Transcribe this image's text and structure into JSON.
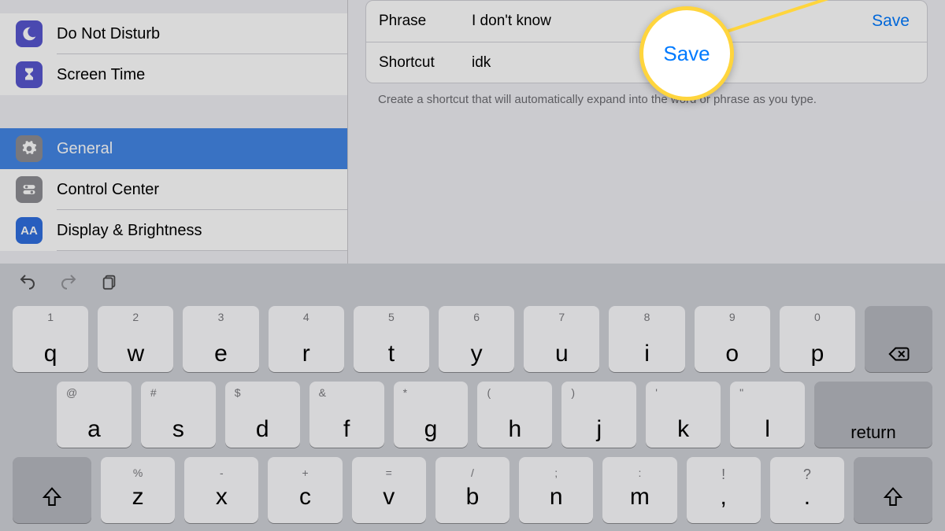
{
  "sidebar": {
    "items": [
      {
        "label": "Do Not Disturb"
      },
      {
        "label": "Screen Time"
      },
      {
        "label": "General"
      },
      {
        "label": "Control Center"
      },
      {
        "label": "Display & Brightness"
      }
    ]
  },
  "form": {
    "phrase_label": "Phrase",
    "phrase_value": "I don't know",
    "shortcut_label": "Shortcut",
    "shortcut_value": "idk",
    "save_label": "Save",
    "helper": "Create a shortcut that will automatically expand into the word or phrase as you type."
  },
  "highlight": {
    "label": "Save"
  },
  "keyboard": {
    "row1": [
      {
        "alt": "1",
        "main": "q"
      },
      {
        "alt": "2",
        "main": "w"
      },
      {
        "alt": "3",
        "main": "e"
      },
      {
        "alt": "4",
        "main": "r"
      },
      {
        "alt": "5",
        "main": "t"
      },
      {
        "alt": "6",
        "main": "y"
      },
      {
        "alt": "7",
        "main": "u"
      },
      {
        "alt": "8",
        "main": "i"
      },
      {
        "alt": "9",
        "main": "o"
      },
      {
        "alt": "0",
        "main": "p"
      }
    ],
    "row2": [
      {
        "alt": "@",
        "main": "a"
      },
      {
        "alt": "#",
        "main": "s"
      },
      {
        "alt": "$",
        "main": "d"
      },
      {
        "alt": "&",
        "main": "f"
      },
      {
        "alt": "*",
        "main": "g"
      },
      {
        "alt": "(",
        "main": "h"
      },
      {
        "alt": ")",
        "main": "j"
      },
      {
        "alt": "'",
        "main": "k"
      },
      {
        "alt": "\"",
        "main": "l"
      }
    ],
    "return_label": "return",
    "row3": [
      {
        "alt": "%",
        "main": "z"
      },
      {
        "alt": "-",
        "main": "x"
      },
      {
        "alt": "+",
        "main": "c"
      },
      {
        "alt": "=",
        "main": "v"
      },
      {
        "alt": "/",
        "main": "b"
      },
      {
        "alt": ";",
        "main": "n"
      },
      {
        "alt": ":",
        "main": "m"
      }
    ],
    "punct": [
      {
        "alt": "!",
        "main": ","
      },
      {
        "alt": "?",
        "main": "."
      }
    ]
  }
}
